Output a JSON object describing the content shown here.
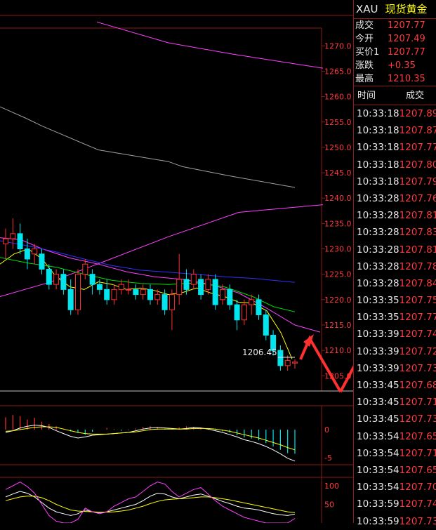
{
  "header": {
    "symbol": "XAU",
    "name": "现货黄金"
  },
  "quote": [
    {
      "label": "成交",
      "value": "1207.77"
    },
    {
      "label": "今开",
      "value": "1207.49"
    },
    {
      "label": "买价1",
      "value": "1207.77"
    },
    {
      "label": "涨跌",
      "value": "+0.35"
    },
    {
      "label": "最高",
      "value": "1210.35"
    }
  ],
  "ticks_header": {
    "time": "时间",
    "price": "成交"
  },
  "ticks": [
    {
      "time": "10:33:18",
      "price": "1207.89"
    },
    {
      "time": "10:33:18",
      "price": "1207.87"
    },
    {
      "time": "10:33:18",
      "price": "1207.77"
    },
    {
      "time": "10:33:18",
      "price": "1207.80"
    },
    {
      "time": "10:33:18",
      "price": "1207.79"
    },
    {
      "time": "10:33:28",
      "price": "1207.76"
    },
    {
      "time": "10:33:28",
      "price": "1207.81"
    },
    {
      "time": "10:33:28",
      "price": "1207.83"
    },
    {
      "time": "10:33:28",
      "price": "1207.81"
    },
    {
      "time": "10:33:28",
      "price": "1207.78"
    },
    {
      "time": "10:33:28",
      "price": "1207.84"
    },
    {
      "time": "10:33:35",
      "price": "1207.75"
    },
    {
      "time": "10:33:35",
      "price": "1207.77"
    },
    {
      "time": "10:33:39",
      "price": "1207.74"
    },
    {
      "time": "10:33:39",
      "price": "1207.72"
    },
    {
      "time": "10:33:39",
      "price": "1207.73"
    },
    {
      "time": "10:33:45",
      "price": "1207.68"
    },
    {
      "time": "10:33:45",
      "price": "1207.71"
    },
    {
      "time": "10:33:45",
      "price": "1207.73"
    },
    {
      "time": "10:33:54",
      "price": "1207.65"
    },
    {
      "time": "10:33:54",
      "price": "1207.71"
    },
    {
      "time": "10:33:54",
      "price": "1207.65"
    },
    {
      "time": "10:33:54",
      "price": "1207.70"
    },
    {
      "time": "10:33:59",
      "price": "1207.74"
    },
    {
      "time": "10:33:59",
      "price": "1207.73"
    }
  ],
  "price_axis": [
    "1270.0",
    "1265.0",
    "1260.0",
    "1255.0",
    "1250.0",
    "1245.0",
    "1240.0",
    "1235.0",
    "1230.0",
    "1225.0",
    "1220.0",
    "1215.0",
    "1210.0",
    "1205.0"
  ],
  "last_price_label": "1206.45",
  "macd_axis": [
    "0",
    "-5"
  ],
  "kdj_axis": [
    "100",
    "50"
  ],
  "colors": {
    "up": "#ff3030",
    "down": "#00e5ee",
    "grid": "#8b1a1a",
    "text_red": "#ff3c3c",
    "ma_yellow": "#ffff00",
    "ma_magenta": "#ff40ff",
    "ma_blue": "#3030ff",
    "ma_green": "#00e000",
    "ma_gray": "#a0a0a0",
    "annotation_arrow": "#ff3030"
  },
  "candles": [
    {
      "o": 1231,
      "h": 1234,
      "l": 1228,
      "c": 1232
    },
    {
      "o": 1232,
      "h": 1236,
      "l": 1230,
      "c": 1233
    },
    {
      "o": 1233,
      "h": 1235,
      "l": 1229,
      "c": 1230
    },
    {
      "o": 1230,
      "h": 1232,
      "l": 1226,
      "c": 1228
    },
    {
      "o": 1229,
      "h": 1231,
      "l": 1227,
      "c": 1230
    },
    {
      "o": 1229,
      "h": 1230,
      "l": 1225,
      "c": 1226
    },
    {
      "o": 1226,
      "h": 1227,
      "l": 1222,
      "c": 1223
    },
    {
      "o": 1223,
      "h": 1226,
      "l": 1222,
      "c": 1225
    },
    {
      "o": 1225,
      "h": 1226,
      "l": 1221,
      "c": 1222
    },
    {
      "o": 1222,
      "h": 1224,
      "l": 1217,
      "c": 1218
    },
    {
      "o": 1218,
      "h": 1226,
      "l": 1217,
      "c": 1225
    },
    {
      "o": 1225,
      "h": 1228,
      "l": 1224,
      "c": 1227
    },
    {
      "o": 1225,
      "h": 1226,
      "l": 1221,
      "c": 1223
    },
    {
      "o": 1223,
      "h": 1224,
      "l": 1221,
      "c": 1222
    },
    {
      "o": 1222,
      "h": 1224,
      "l": 1219,
      "c": 1220
    },
    {
      "o": 1220,
      "h": 1223,
      "l": 1219,
      "c": 1222
    },
    {
      "o": 1222,
      "h": 1224,
      "l": 1221,
      "c": 1223
    },
    {
      "o": 1222,
      "h": 1224,
      "l": 1221,
      "c": 1222
    },
    {
      "o": 1222,
      "h": 1223,
      "l": 1220,
      "c": 1221
    },
    {
      "o": 1221,
      "h": 1223,
      "l": 1220,
      "c": 1222
    },
    {
      "o": 1222,
      "h": 1223,
      "l": 1219,
      "c": 1220
    },
    {
      "o": 1220,
      "h": 1222,
      "l": 1219,
      "c": 1221
    },
    {
      "o": 1221,
      "h": 1222,
      "l": 1217,
      "c": 1218
    },
    {
      "o": 1218,
      "h": 1222,
      "l": 1214,
      "c": 1221
    },
    {
      "o": 1221,
      "h": 1229,
      "l": 1219,
      "c": 1224
    },
    {
      "o": 1224,
      "h": 1226,
      "l": 1221,
      "c": 1222
    },
    {
      "o": 1223,
      "h": 1226,
      "l": 1222,
      "c": 1225
    },
    {
      "o": 1224,
      "h": 1225,
      "l": 1220,
      "c": 1221
    },
    {
      "o": 1222,
      "h": 1225,
      "l": 1221,
      "c": 1224
    },
    {
      "o": 1224,
      "h": 1225,
      "l": 1218,
      "c": 1219
    },
    {
      "o": 1220,
      "h": 1223,
      "l": 1219,
      "c": 1222
    },
    {
      "o": 1222,
      "h": 1223,
      "l": 1218,
      "c": 1219
    },
    {
      "o": 1219,
      "h": 1220,
      "l": 1214,
      "c": 1216
    },
    {
      "o": 1216,
      "h": 1220,
      "l": 1215,
      "c": 1219
    },
    {
      "o": 1219,
      "h": 1221,
      "l": 1217,
      "c": 1220
    },
    {
      "o": 1220,
      "h": 1221,
      "l": 1216,
      "c": 1217
    },
    {
      "o": 1217,
      "h": 1218,
      "l": 1212,
      "c": 1213
    },
    {
      "o": 1213,
      "h": 1214,
      "l": 1209,
      "c": 1210
    },
    {
      "o": 1210,
      "h": 1211,
      "l": 1206,
      "c": 1207
    },
    {
      "o": 1207,
      "h": 1209,
      "l": 1206,
      "c": 1208
    },
    {
      "o": 1207.5,
      "h": 1208.2,
      "l": 1206.4,
      "c": 1207.7
    }
  ],
  "ma_lines": [
    {
      "color": "#a0a0a0",
      "points": [
        [
          -10,
          1258.6
        ],
        [
          36,
          1255.8
        ],
        [
          60,
          1254.2
        ]
      ]
    },
    {
      "color": "#a0a0a0",
      "points": [
        [
          60,
          1254.2
        ],
        [
          140,
          1249.5
        ],
        [
          240,
          1247.2
        ],
        [
          260,
          1246.2
        ],
        [
          326,
          1244.4
        ],
        [
          420,
          1242.1
        ]
      ]
    },
    {
      "color": "#ff40ff",
      "points": [
        [
          138,
          1274.7
        ],
        [
          240,
          1270.6
        ],
        [
          330,
          1268.4
        ],
        [
          460,
          1265.6
        ]
      ]
    },
    {
      "color": "#ff40ff",
      "points": [
        [
          0,
          1220.6
        ],
        [
          70,
          1223.4
        ],
        [
          150,
          1227.6
        ],
        [
          240,
          1232.4
        ],
        [
          340,
          1237.2
        ],
        [
          460,
          1238.7
        ]
      ]
    }
  ],
  "ma_short": [
    {
      "color": "#ffff00",
      "points": [
        [
          0,
          1227.0
        ],
        [
          20,
          1229.0
        ],
        [
          40,
          1230.0
        ],
        [
          60,
          1228.0
        ],
        [
          80,
          1224.5
        ],
        [
          100,
          1222.5
        ],
        [
          120,
          1222.0
        ],
        [
          140,
          1223.5
        ],
        [
          160,
          1223.0
        ],
        [
          180,
          1222.0
        ],
        [
          200,
          1222.3
        ],
        [
          220,
          1221.8
        ],
        [
          240,
          1221.0
        ],
        [
          260,
          1221.4
        ],
        [
          280,
          1222.3
        ],
        [
          300,
          1221.3
        ],
        [
          320,
          1220.6
        ],
        [
          340,
          1219.5
        ],
        [
          360,
          1219.3
        ],
        [
          380,
          1217.8
        ],
        [
          400,
          1213.5
        ],
        [
          416,
          1208.3
        ]
      ]
    },
    {
      "color": "#ff40ff",
      "points": [
        [
          0,
          1232.2
        ],
        [
          30,
          1231.8
        ],
        [
          60,
          1230.0
        ],
        [
          100,
          1228.2
        ],
        [
          140,
          1227.0
        ],
        [
          180,
          1225.5
        ],
        [
          220,
          1224.5
        ],
        [
          260,
          1224.0
        ],
        [
          300,
          1223.0
        ],
        [
          340,
          1221.3
        ],
        [
          380,
          1218.3
        ],
        [
          420,
          1215.0
        ],
        [
          456,
          1213.6
        ]
      ]
    },
    {
      "color": "#00e000",
      "points": [
        [
          0,
          1228.3
        ],
        [
          40,
          1227.2
        ],
        [
          80,
          1226.4
        ],
        [
          120,
          1225.0
        ],
        [
          160,
          1223.8
        ],
        [
          200,
          1223.2
        ],
        [
          240,
          1223.0
        ],
        [
          280,
          1223.3
        ],
        [
          320,
          1222.5
        ],
        [
          360,
          1220.6
        ],
        [
          390,
          1218.6
        ],
        [
          420,
          1217.6
        ]
      ]
    },
    {
      "color": "#3030ff",
      "points": [
        [
          0,
          1231.6
        ],
        [
          40,
          1230.6
        ],
        [
          80,
          1229.4
        ],
        [
          120,
          1228.0
        ],
        [
          160,
          1226.7
        ],
        [
          200,
          1225.8
        ],
        [
          240,
          1225.4
        ],
        [
          280,
          1225.0
        ],
        [
          320,
          1224.5
        ],
        [
          360,
          1224.2
        ],
        [
          390,
          1223.8
        ],
        [
          420,
          1223.4
        ]
      ]
    }
  ],
  "macd": {
    "bars": [
      2.2,
      2.6,
      2.4,
      1.8,
      2.1,
      1.4,
      1.0,
      0.6,
      0.2,
      -0.3,
      -0.6,
      -0.9,
      -0.4,
      0.0,
      0.3,
      0.1,
      -0.2,
      -0.1,
      0.2,
      0.5,
      0.6,
      0.3,
      0.2,
      0.1,
      0.4,
      0.6,
      0.5,
      0.3,
      0.1,
      -0.1,
      -0.3,
      -0.5,
      -1.0,
      -1.4,
      -1.6,
      -1.9,
      -2.4,
      -3.0,
      -3.6,
      -4.2,
      -4.3
    ],
    "dif": [
      -0.5,
      -0.2,
      0.3,
      0.6,
      0.8,
      0.7,
      0.4,
      -0.2,
      -0.7,
      -1.2,
      -1.5,
      -1.3,
      -1.0,
      -0.9,
      -0.8,
      -0.7,
      -0.6,
      -0.5,
      -0.2,
      0.1,
      0.3,
      0.4,
      0.3,
      0.2,
      0.1,
      0.2,
      0.4,
      0.3,
      0.1,
      -0.2,
      -0.5,
      -0.9,
      -1.3,
      -1.8,
      -2.1,
      -2.5,
      -3.0,
      -3.6,
      -4.3,
      -5.1,
      -5.6
    ],
    "dea": [
      -0.3,
      -0.2,
      0.0,
      0.2,
      0.4,
      0.5,
      0.5,
      0.4,
      0.1,
      -0.2,
      -0.5,
      -0.7,
      -0.8,
      -0.8,
      -0.8,
      -0.7,
      -0.6,
      -0.5,
      -0.4,
      -0.2,
      0.0,
      0.1,
      0.1,
      0.1,
      0.1,
      0.1,
      0.2,
      0.2,
      0.2,
      0.1,
      -0.1,
      -0.3,
      -0.6,
      -0.9,
      -1.2,
      -1.5,
      -1.9,
      -2.3,
      -2.7,
      -3.2,
      -3.6
    ]
  },
  "kdj": {
    "k": [
      70,
      78,
      85,
      80,
      70,
      55,
      40,
      30,
      25,
      20,
      25,
      35,
      30,
      28,
      30,
      35,
      40,
      45,
      50,
      60,
      72,
      80,
      78,
      70,
      65,
      70,
      75,
      78,
      72,
      65,
      58,
      52,
      45,
      40,
      38,
      35,
      30,
      25,
      22,
      20,
      24
    ],
    "d": [
      60,
      65,
      70,
      72,
      72,
      68,
      60,
      50,
      42,
      35,
      32,
      31,
      30,
      29,
      29,
      30,
      32,
      35,
      40,
      45,
      52,
      58,
      62,
      64,
      65,
      66,
      68,
      70,
      70,
      68,
      65,
      62,
      58,
      54,
      50,
      46,
      42,
      38,
      34,
      30,
      28
    ],
    "j": [
      90,
      100,
      110,
      98,
      80,
      50,
      20,
      5,
      0,
      -5,
      10,
      40,
      30,
      25,
      30,
      45,
      55,
      65,
      70,
      85,
      100,
      110,
      105,
      85,
      70,
      80,
      90,
      95,
      78,
      60,
      45,
      35,
      25,
      15,
      10,
      5,
      0,
      0,
      0,
      0,
      12
    ]
  }
}
